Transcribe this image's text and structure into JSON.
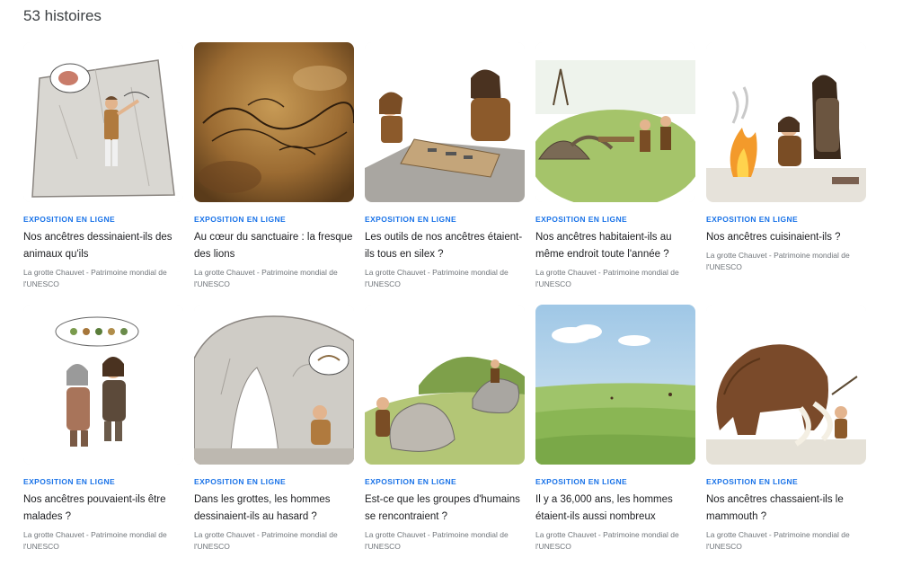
{
  "header": {
    "count_label": "53 histoires"
  },
  "stories": [
    {
      "kicker": "EXPOSITION EN LIGNE",
      "title": "Nos ancêtres dessinaient-ils des animaux qu'ils",
      "source": "La grotte Chauvet - Patrimoine mondial de l'UNESCO",
      "image": "caveman-drawing-on-rock"
    },
    {
      "kicker": "EXPOSITION EN LIGNE",
      "title": "Au cœur du sanctuaire : la fresque des lions",
      "source": "La grotte Chauvet - Patrimoine mondial de l'UNESCO",
      "image": "cave-wall-fresco-photo"
    },
    {
      "kicker": "EXPOSITION EN LIGNE",
      "title": "Les outils de nos ancêtres étaient-ils tous en silex ?",
      "source": "La grotte Chauvet - Patrimoine mondial de l'UNESCO",
      "image": "cavemen-with-tools"
    },
    {
      "kicker": "EXPOSITION EN LIGNE",
      "title": "Nos ancêtres habitaient-ils au même endroit toute l'année ?",
      "source": "La grotte Chauvet - Patrimoine mondial de l'UNESCO",
      "image": "camp-with-huts"
    },
    {
      "kicker": "EXPOSITION EN LIGNE",
      "title": "Nos ancêtres cuisinaient-ils ?",
      "source": "La grotte Chauvet - Patrimoine mondial de l'UNESCO",
      "image": "cooking-by-fire"
    },
    {
      "kicker": "EXPOSITION EN LIGNE",
      "title": "Nos ancêtres pouvaient-ils être malades ?",
      "source": "La grotte Chauvet - Patrimoine mondial de l'UNESCO",
      "image": "healer-with-plants"
    },
    {
      "kicker": "EXPOSITION EN LIGNE",
      "title": "Dans les grottes, les hommes dessinaient-ils au hasard ?",
      "source": "La grotte Chauvet - Patrimoine mondial de l'UNESCO",
      "image": "cave-entrance"
    },
    {
      "kicker": "EXPOSITION EN LIGNE",
      "title": "Est-ce que les groupes d'humains se rencontraient ?",
      "source": "La grotte Chauvet - Patrimoine mondial de l'UNESCO",
      "image": "groups-meeting-rocks"
    },
    {
      "kicker": "EXPOSITION EN LIGNE",
      "title": "Il y a 36,000 ans, les hommes étaient-ils aussi nombreux",
      "source": "La grotte Chauvet - Patrimoine mondial de l'UNESCO",
      "image": "green-plain-landscape"
    },
    {
      "kicker": "EXPOSITION EN LIGNE",
      "title": "Nos ancêtres chassaient-ils le mammouth ?",
      "source": "La grotte Chauvet - Patrimoine mondial de l'UNESCO",
      "image": "mammoth-hunt"
    }
  ]
}
